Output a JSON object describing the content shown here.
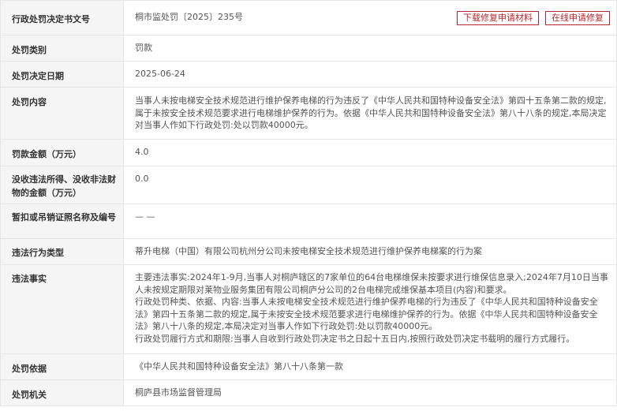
{
  "doc_number": {
    "label": "行政处罚决定书文号",
    "value": "桐市监处罚〔2025〕235号"
  },
  "buttons": {
    "download": "下载修复申请材料",
    "apply": "在线申请修复"
  },
  "category": {
    "label": "处罚类别",
    "value": "罚款"
  },
  "date": {
    "label": "处罚决定日期",
    "value": "2025-06-24"
  },
  "content": {
    "label": "处罚内容",
    "value": "当事人未按电梯安全技术规范进行维护保养电梯的行为违反了《中华人民共和国特种设备安全法》第四十五条第二款的规定,属于未按安全技术规范要求进行电梯维护保养的行为。依据《中华人民共和国特种设备安全法》第八十八条的规定,本局决定对当事人作如下行政处罚:处以罚款40000元。"
  },
  "fine": {
    "label": "罚款金额（万元）",
    "value": "4.0"
  },
  "confiscation": {
    "label": "没收违法所得、没收非法财物的金额（万元）",
    "value": "0.0"
  },
  "license": {
    "label": "暂扣或吊销证照名称及编号",
    "value": "— —"
  },
  "violation_type": {
    "label": "违法行为类型",
    "value": "蒂升电梯（中国）有限公司杭州分公司未按电梯安全技术规范进行维护保养电梯案的行为案"
  },
  "facts": {
    "label": "违法事实",
    "p1": "主要违法事实:2024年1-9月,当事人对桐庐辖区的7家单位的64台电梯维保未按要求进行维保信息录入;2024年7月10日当事人未按规定期限对莱物业服务集团有限公司桐庐分公司的2台电梯完成维保基本项目(内容)和要求。",
    "p2": "行政处罚种类、依据、内容:当事人未按电梯安全技术规范进行维护保养电梯的行为违反了《中华人民共和国特种设备安全法》第四十五条第二款的规定,属于未按安全技术规范要求进行电梯维护保养的行为。依据《中华人民共和国特种设备安全法》第八十八条的规定,本局决定对当事人作如下行政处罚:处以罚款40000元。",
    "p3": "行政处罚履行方式和期限:当事人自收到行政处罚决定书之日起十五日内,按照行政处罚决定书载明的履行方式履行。"
  },
  "basis": {
    "label": "处罚依据",
    "value": "《中华人民共和国特种设备安全法》第八十八条第一款"
  },
  "authority": {
    "label": "处罚机关",
    "value": "桐庐县市场监督管理局"
  }
}
